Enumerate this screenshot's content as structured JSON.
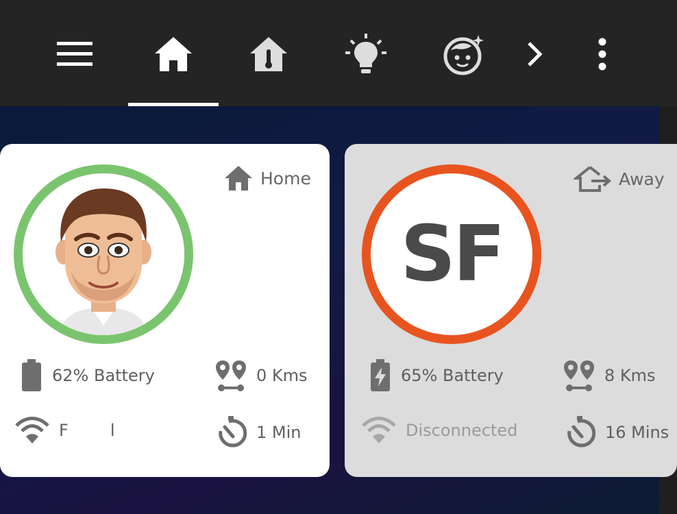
{
  "topbar": {
    "icons": [
      "menu-icon",
      "home-icon",
      "home-thermometer-icon",
      "lightbulb-icon",
      "face-sparkle-icon",
      "chevron-right-icon",
      "more-vertical-icon"
    ],
    "active_tab": "home"
  },
  "cards": [
    {
      "state": "Home",
      "avatar": "bitmoji-avatar",
      "ring_color": "#7bc46f",
      "battery": "62% Battery",
      "distance": "0 Kms",
      "wifi": "F        l",
      "duration": "1 Min"
    },
    {
      "state": "Away",
      "initials": "SF",
      "ring_color": "#e8541f",
      "battery": "65% Battery",
      "distance": "8 Kms",
      "wifi": "Disconnected",
      "duration": "16 Mins"
    }
  ],
  "colors": {
    "topbar": "#242424",
    "home_card": "#ffffff",
    "away_card": "#dcdcdc",
    "icon_gray": "#6e6e6e"
  }
}
